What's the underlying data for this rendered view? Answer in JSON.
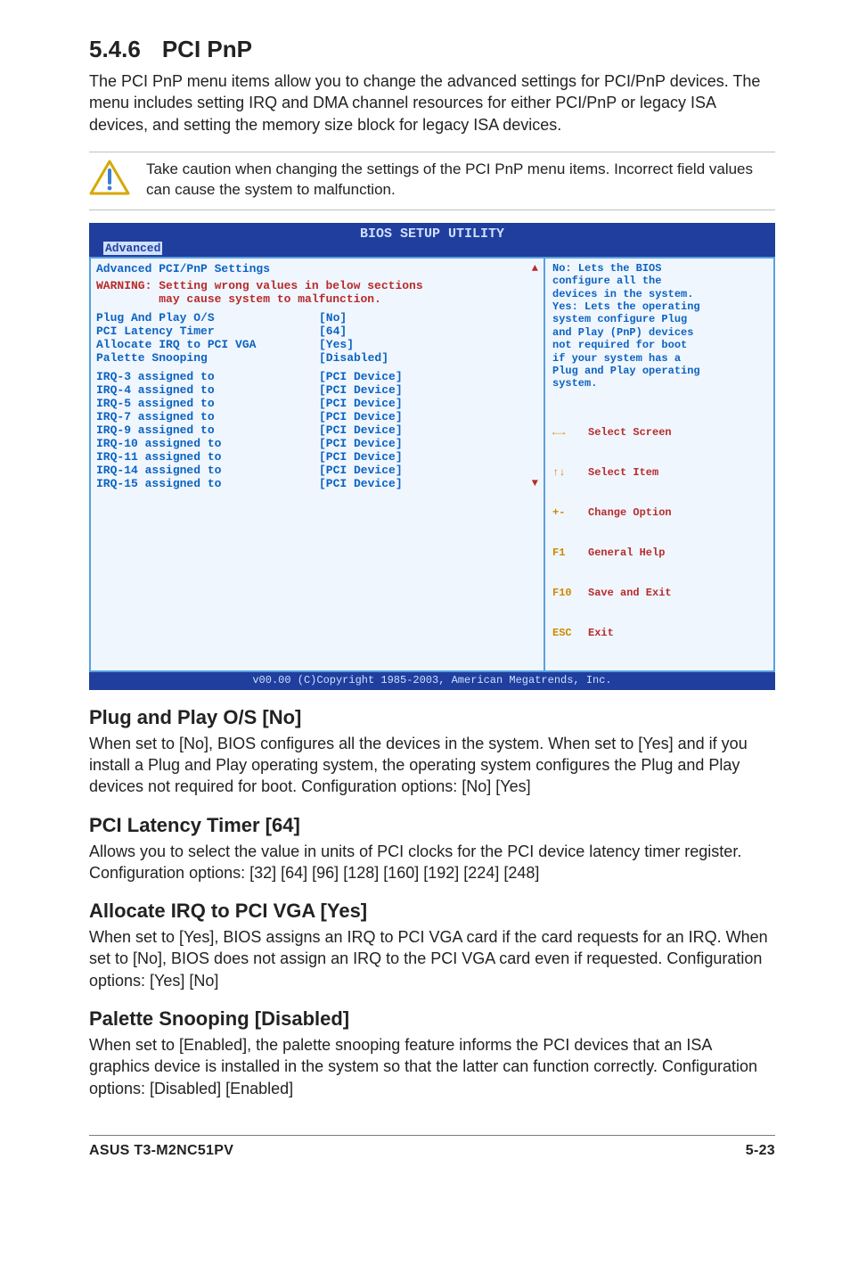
{
  "header": {
    "num": "5.4.6",
    "title": "PCI PnP"
  },
  "intro": "The PCI PnP menu items allow you to change the advanced settings for PCI/PnP devices. The menu includes setting IRQ and DMA channel resources for either PCI/PnP or legacy ISA devices, and setting the memory size block for legacy ISA devices.",
  "caution": "Take caution when changing the settings of the PCI PnP menu items. Incorrect field values can cause the system to malfunction.",
  "bios": {
    "title": "BIOS SETUP UTILITY",
    "active_tab": "Advanced",
    "panel_title": "Advanced PCI/PnP Settings",
    "warning": "WARNING: Setting wrong values in below sections\n         may cause system to malfunction.",
    "settings": [
      {
        "k": "Plug And Play O/S",
        "v": "[No]"
      },
      {
        "k": "PCI Latency Timer",
        "v": "[64]"
      },
      {
        "k": "Allocate IRQ to PCI VGA",
        "v": "[Yes]"
      },
      {
        "k": "Palette Snooping",
        "v": "[Disabled]"
      }
    ],
    "irq": [
      {
        "k": "IRQ-3 assigned to",
        "v": "[PCI Device]"
      },
      {
        "k": "IRQ-4 assigned to",
        "v": "[PCI Device]"
      },
      {
        "k": "IRQ-5 assigned to",
        "v": "[PCI Device]"
      },
      {
        "k": "IRQ-7 assigned to",
        "v": "[PCI Device]"
      },
      {
        "k": "IRQ-9 assigned to",
        "v": "[PCI Device]"
      },
      {
        "k": "IRQ-10 assigned to",
        "v": "[PCI Device]"
      },
      {
        "k": "IRQ-11 assigned to",
        "v": "[PCI Device]"
      },
      {
        "k": "IRQ-14 assigned to",
        "v": "[PCI Device]"
      },
      {
        "k": "IRQ-15 assigned to",
        "v": "[PCI Device]"
      }
    ],
    "help": "No: Lets the BIOS\nconfigure all the\ndevices in the system.\nYes: Lets the operating\nsystem configure Plug\nand Play (PnP) devices\nnot required for boot\nif your system has a\nPlug and Play operating\nsystem.",
    "keys": [
      {
        "key": "←→",
        "label": "Select Screen"
      },
      {
        "key": "↑↓",
        "label": "Select Item"
      },
      {
        "key": "+-",
        "label": "Change Option"
      },
      {
        "key": "F1",
        "label": "General Help"
      },
      {
        "key": "F10",
        "label": "Save and Exit"
      },
      {
        "key": "ESC",
        "label": "Exit"
      }
    ],
    "footer": "v00.00 (C)Copyright 1985-2003, American Megatrends, Inc."
  },
  "sections": [
    {
      "h": "Plug and Play O/S [No]",
      "p": "When set to [No], BIOS configures all the devices in the system. When set to [Yes] and if you install a Plug and Play operating system, the operating system configures the Plug and Play devices not required for boot. Configuration options: [No] [Yes]"
    },
    {
      "h": "PCI Latency Timer [64]",
      "p": "Allows you to select the value in units of PCI clocks for the PCI device latency timer register. Configuration options: [32] [64] [96] [128] [160] [192] [224] [248]"
    },
    {
      "h": "Allocate IRQ to PCI VGA [Yes]",
      "p": "When set to [Yes], BIOS assigns an IRQ to PCI VGA card if the card requests for an IRQ. When set to [No], BIOS does not assign an IRQ to the PCI VGA card even if requested. Configuration options: [Yes] [No]"
    },
    {
      "h": "Palette Snooping [Disabled]",
      "p": "When set to [Enabled], the palette snooping feature informs the PCI devices that an ISA graphics device is installed in the system so that the latter can function correctly. Configuration options: [Disabled] [Enabled]"
    }
  ],
  "footer": {
    "left": "ASUS T3-M2NC51PV",
    "right": "5-23"
  }
}
